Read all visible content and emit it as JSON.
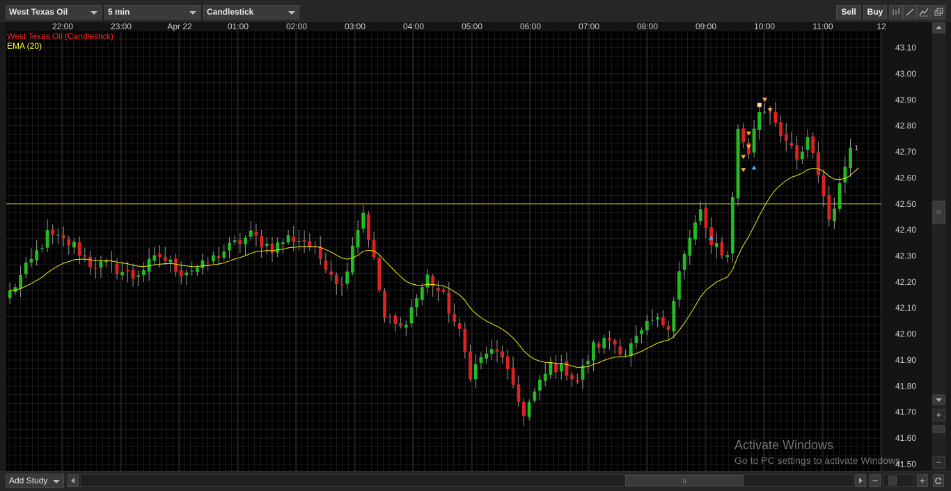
{
  "toolbar": {
    "symbol": "West Texas Oil",
    "interval": "5 min",
    "chart_type": "Candlestick",
    "sell_label": "Sell",
    "buy_label": "Buy",
    "icons": [
      "bar-chart-icon",
      "line-draw-icon",
      "chart-style-icon",
      "popout-window-icon"
    ]
  },
  "legend": {
    "main_label": "West Texas Oil (Candlestick)",
    "main_color": "#ff2222",
    "ema_label": "EMA (20)",
    "ema_color": "#ffff33"
  },
  "colors": {
    "up": "#22bb22",
    "down": "#dd2222",
    "wick": "#999999",
    "ema": "#f2f200",
    "hline": "#d8d800",
    "grid": "#2c2c2c",
    "background": "#000000"
  },
  "chart_data": {
    "type": "candlestick",
    "title": "",
    "x_ticks": [
      "22:00",
      "23:00",
      "Apr 22",
      "01:00",
      "02:00",
      "03:00",
      "04:00",
      "05:00",
      "06:00",
      "07:00",
      "08:00",
      "09:00",
      "10:00",
      "11:00",
      "12"
    ],
    "y_ticks": [
      "43.10",
      "43.00",
      "42.90",
      "42.80",
      "42.70",
      "42.60",
      "42.50",
      "42.40",
      "42.30",
      "42.20",
      "42.10",
      "42.00",
      "41.90",
      "41.80",
      "41.70",
      "41.60",
      "41.50"
    ],
    "ylim": [
      41.49,
      43.18
    ],
    "horizontal_line": 42.5,
    "ema_period": 20,
    "grid": true,
    "last_marker": "1",
    "close_path": [
      [
        0,
        42.16
      ],
      [
        4,
        42.28
      ],
      [
        7,
        42.38
      ],
      [
        12,
        42.34
      ],
      [
        15,
        42.27
      ],
      [
        19,
        42.26
      ],
      [
        23,
        42.22
      ],
      [
        28,
        42.3
      ],
      [
        32,
        42.24
      ],
      [
        36,
        42.26
      ],
      [
        40,
        42.32
      ],
      [
        45,
        42.38
      ],
      [
        49,
        42.33
      ],
      [
        52,
        42.37
      ],
      [
        55,
        42.36
      ],
      [
        59,
        42.27
      ],
      [
        62,
        42.18
      ],
      [
        64,
        42.35
      ],
      [
        66,
        42.47
      ],
      [
        68,
        42.28
      ],
      [
        70,
        42.06
      ],
      [
        73,
        42.02
      ],
      [
        75,
        42.1
      ],
      [
        78,
        42.22
      ],
      [
        81,
        42.14
      ],
      [
        84,
        42.0
      ],
      [
        86,
        41.85
      ],
      [
        89,
        41.93
      ],
      [
        92,
        41.92
      ],
      [
        94,
        41.78
      ],
      [
        96,
        41.7
      ],
      [
        98,
        41.77
      ],
      [
        101,
        41.88
      ],
      [
        104,
        41.86
      ],
      [
        106,
        41.82
      ],
      [
        109,
        41.95
      ],
      [
        112,
        41.98
      ],
      [
        115,
        41.93
      ],
      [
        118,
        42.0
      ],
      [
        120,
        42.05
      ],
      [
        123,
        42.04
      ],
      [
        125,
        42.24
      ],
      [
        127,
        42.36
      ],
      [
        129,
        42.48
      ],
      [
        131,
        42.32
      ],
      [
        132,
        42.34
      ],
      [
        134,
        42.3
      ],
      [
        136,
        42.78
      ],
      [
        138,
        42.7
      ],
      [
        140,
        42.86
      ],
      [
        142,
        42.86
      ],
      [
        144,
        42.78
      ],
      [
        147,
        42.66
      ],
      [
        149,
        42.74
      ],
      [
        151,
        42.62
      ],
      [
        153,
        42.44
      ],
      [
        155,
        42.56
      ],
      [
        157,
        42.74
      ]
    ],
    "markers": [
      {
        "type": "sell",
        "shape": "triangle-down",
        "color": "#ffaa44",
        "index": 137,
        "price": 42.63
      },
      {
        "type": "sell",
        "shape": "triangle-down",
        "color": "#ffaa44",
        "index": 137,
        "price": 42.68
      },
      {
        "type": "sell",
        "shape": "triangle-down",
        "color": "#ffaa44",
        "index": 138,
        "price": 42.72
      },
      {
        "type": "sell",
        "shape": "triangle-down",
        "color": "#ffaa44",
        "index": 138,
        "price": 42.77
      },
      {
        "type": "sell",
        "shape": "triangle-down",
        "color": "#ffaa44",
        "index": 141,
        "price": 42.9
      },
      {
        "type": "sell",
        "shape": "triangle-down",
        "color": "#ffaa44",
        "index": 142,
        "price": 42.86
      },
      {
        "type": "note",
        "shape": "square",
        "color": "#ffddaa",
        "index": 140,
        "price": 42.88
      },
      {
        "type": "buy",
        "shape": "triangle-up",
        "color": "#44aaff",
        "index": 131,
        "price": 42.37
      },
      {
        "type": "buy",
        "shape": "triangle-up",
        "color": "#44aaff",
        "index": 139,
        "price": 42.64
      }
    ]
  },
  "bottom": {
    "add_study": "Add Study"
  },
  "watermark": {
    "line1": "Activate Windows",
    "line2": "Go to PC settings to activate Windows."
  }
}
